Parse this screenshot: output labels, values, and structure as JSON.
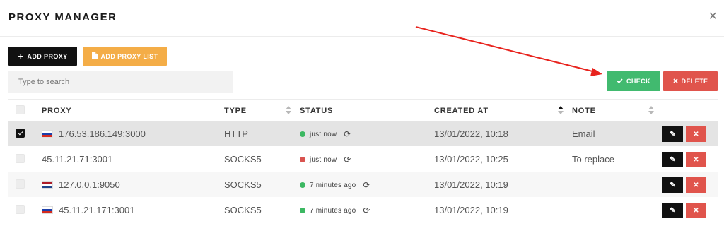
{
  "header": {
    "title": "PROXY MANAGER",
    "close_label": "×"
  },
  "toolbar": {
    "add_proxy_label": "ADD PROXY",
    "add_proxy_list_label": "ADD PROXY LIST",
    "check_label": "CHECK",
    "delete_label": "DELETE"
  },
  "search": {
    "placeholder": "Type to search",
    "value": ""
  },
  "table": {
    "columns": [
      "PROXY",
      "TYPE",
      "STATUS",
      "CREATED AT",
      "NOTE"
    ],
    "sort_column": "CREATED AT",
    "rows": [
      {
        "selected": true,
        "flag": "russia",
        "proxy": "176.53.186.149:3000",
        "type": "HTTP",
        "status": "just now",
        "status_color": "#3cb862",
        "created_at": "13/01/2022, 10:18",
        "note": "Email"
      },
      {
        "selected": false,
        "flag": "",
        "proxy": "45.11.21.71:3001",
        "type": "SOCKS5",
        "status": "just now",
        "status_color": "#d9534f",
        "created_at": "13/01/2022, 10:25",
        "note": "To replace"
      },
      {
        "selected": false,
        "flag": "netherlands",
        "proxy": "127.0.0.1:9050",
        "type": "SOCKS5",
        "status": "7 minutes ago",
        "status_color": "#3cb862",
        "created_at": "13/01/2022, 10:19",
        "note": ""
      },
      {
        "selected": false,
        "flag": "russia",
        "proxy": "45.11.21.171:3001",
        "type": "SOCKS5",
        "status": "7 minutes ago",
        "status_color": "#3cb862",
        "created_at": "13/01/2022, 10:19",
        "note": ""
      }
    ]
  },
  "icons": {
    "check": "check-icon",
    "delete": "x-icon",
    "edit": "pencil-icon",
    "refresh": "refresh-icon",
    "add": "plus-icon",
    "list": "file-icon"
  },
  "colors": {
    "check": "#41ba6f",
    "delete": "#e0544c",
    "add_list": "#f4ad47",
    "add": "#111111",
    "arrow": "#e8231d"
  }
}
